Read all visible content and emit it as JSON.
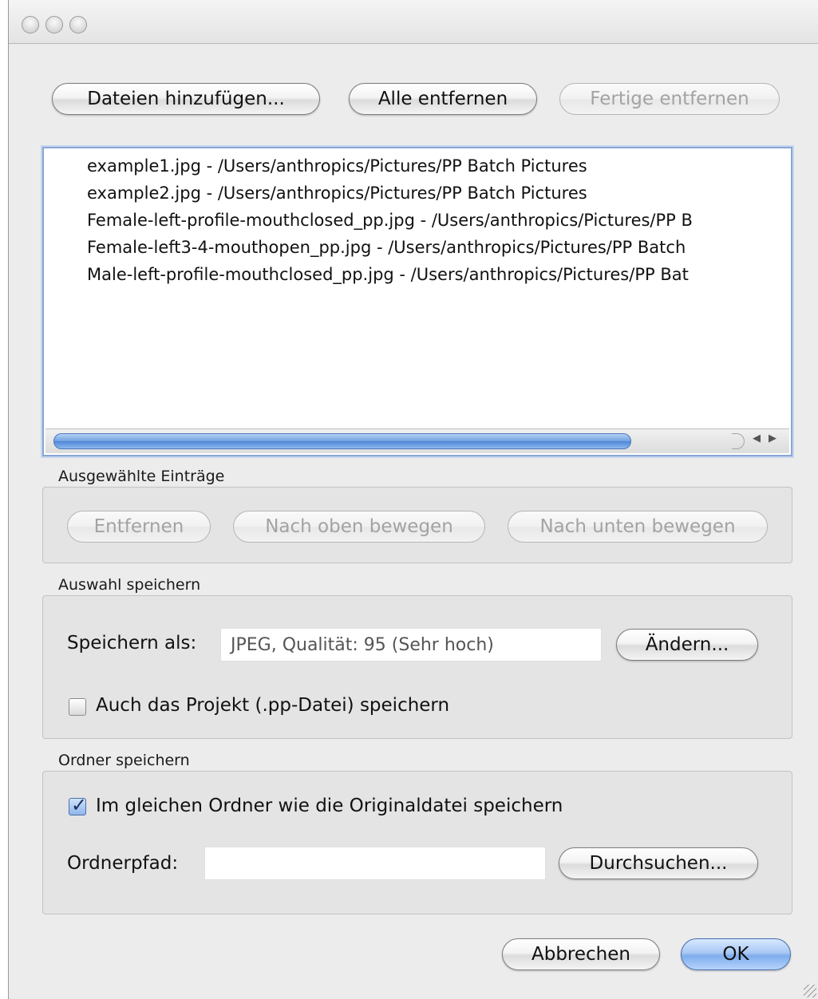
{
  "toolbar": {
    "add_files": "Dateien hinzufügen...",
    "remove_all": "Alle entfernen",
    "remove_done": "Fertige entfernen"
  },
  "files": [
    "example1.jpg  -  /Users/anthropics/Pictures/PP Batch Pictures",
    "example2.jpg  -  /Users/anthropics/Pictures/PP Batch Pictures",
    "Female-left-profile-mouthclosed_pp.jpg  -  /Users/anthropics/Pictures/PP B",
    "Female-left3-4-mouthopen_pp.jpg  -  /Users/anthropics/Pictures/PP Batch",
    "Male-left-profile-mouthclosed_pp.jpg  -  /Users/anthropics/Pictures/PP Bat"
  ],
  "selected_entries": {
    "title": "Ausgewählte Einträge",
    "remove": "Entfernen",
    "move_up": "Nach oben bewegen",
    "move_down": "Nach unten bewegen"
  },
  "save_selection": {
    "title": "Auswahl speichern",
    "save_as_label": "Speichern als:",
    "save_as_value": "JPEG, Qualität: 95 (Sehr hoch)",
    "change_button": "Ändern...",
    "save_project_label": "Auch das Projekt (.pp-Datei) speichern",
    "save_project_checked": false
  },
  "save_folder": {
    "title": "Ordner speichern",
    "same_folder_label": "Im gleichen Ordner wie die Originaldatei speichern",
    "same_folder_checked": true,
    "folder_path_label": "Ordnerpfad:",
    "folder_path_value": "",
    "browse_button": "Durchsuchen..."
  },
  "footer": {
    "cancel": "Abbrechen",
    "ok": "OK"
  },
  "colors": {
    "accent": "#7fadec",
    "selection_border": "#8aa6d3"
  }
}
